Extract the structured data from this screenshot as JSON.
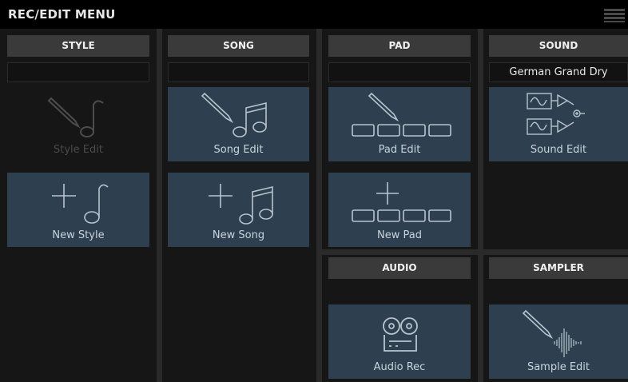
{
  "app": {
    "title": "REC/EDIT MENU",
    "menu_icon": "list-icon"
  },
  "style": {
    "header": "STYLE",
    "name": "",
    "edit_label": "Style Edit",
    "new_label": "New Style"
  },
  "song": {
    "header": "SONG",
    "name": "",
    "edit_label": "Song Edit",
    "new_label": "New Song"
  },
  "pad": {
    "header": "PAD",
    "name": "",
    "edit_label": "Pad Edit",
    "new_label": "New Pad"
  },
  "sound": {
    "header": "SOUND",
    "name": "German Grand Dry",
    "edit_label": "Sound Edit"
  },
  "audio": {
    "header": "AUDIO",
    "rec_label": "Audio Rec"
  },
  "sampler": {
    "header": "SAMPLER",
    "edit_label": "Sample Edit"
  },
  "colors": {
    "tile": "#2e4050",
    "header": "#3a3a3a",
    "icon": "#c9d3dc",
    "disabled_icon": "#555555"
  }
}
